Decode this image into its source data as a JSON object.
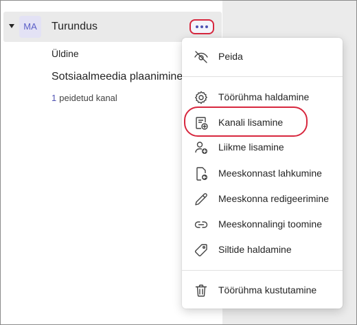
{
  "team": {
    "avatar_initials": "MA",
    "name": "Turundus"
  },
  "channels": [
    {
      "label": "Üldine"
    },
    {
      "label": "Sotsiaalmeedia plaanimine"
    }
  ],
  "hidden_channels": {
    "count": "1",
    "label": "peidetud kanal"
  },
  "menu": {
    "items": [
      {
        "label": "Peida",
        "icon": "eye-off-icon"
      },
      {
        "label": "Töörühma haldamine",
        "icon": "gear-icon"
      },
      {
        "label": "Kanali lisamine",
        "icon": "add-channel-icon"
      },
      {
        "label": "Liikme lisamine",
        "icon": "add-person-icon"
      },
      {
        "label": "Meeskonnast lahkumine",
        "icon": "leave-team-icon"
      },
      {
        "label": "Meeskonna redigeerimine",
        "icon": "pencil-icon"
      },
      {
        "label": "Meeskonnalingi toomine",
        "icon": "link-icon"
      },
      {
        "label": "Siltide haldamine",
        "icon": "tag-icon"
      },
      {
        "label": "Töörühma kustutamine",
        "icon": "trash-icon"
      }
    ],
    "highlighted_item": "Kanali lisamine"
  },
  "colors": {
    "accent": "#4f52b2",
    "annotation_red": "#d7263d",
    "avatar_bg": "#e3e2f5"
  }
}
